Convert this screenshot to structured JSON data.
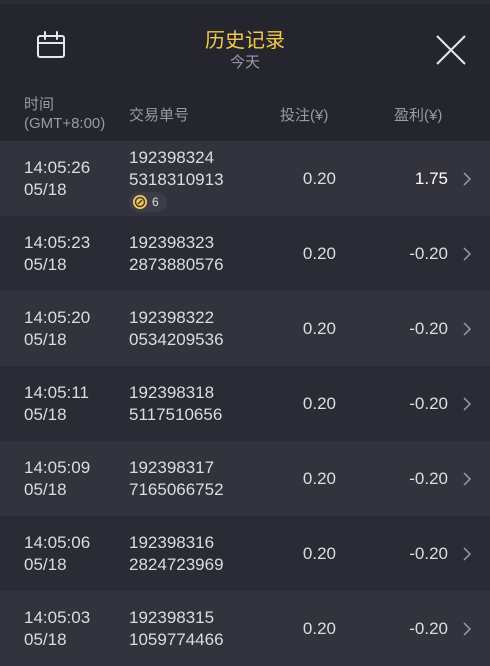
{
  "header": {
    "title": "历史记录",
    "subtitle": "今天"
  },
  "columns": {
    "time_line1": "时间",
    "time_line2": "(GMT+8:00)",
    "order": "交易单号",
    "bet": "投注(¥)",
    "profit": "盈利(¥)"
  },
  "rows": [
    {
      "time": "14:05:26",
      "date": "05/18",
      "order1": "192398324",
      "order2": "5318310913",
      "bet": "0.20",
      "profit": "1.75",
      "badge": "6"
    },
    {
      "time": "14:05:23",
      "date": "05/18",
      "order1": "192398323",
      "order2": "2873880576",
      "bet": "0.20",
      "profit": "-0.20"
    },
    {
      "time": "14:05:20",
      "date": "05/18",
      "order1": "192398322",
      "order2": "0534209536",
      "bet": "0.20",
      "profit": "-0.20"
    },
    {
      "time": "14:05:11",
      "date": "05/18",
      "order1": "192398318",
      "order2": "5117510656",
      "bet": "0.20",
      "profit": "-0.20"
    },
    {
      "time": "14:05:09",
      "date": "05/18",
      "order1": "192398317",
      "order2": "7165066752",
      "bet": "0.20",
      "profit": "-0.20"
    },
    {
      "time": "14:05:06",
      "date": "05/18",
      "order1": "192398316",
      "order2": "2824723969",
      "bet": "0.20",
      "profit": "-0.20"
    },
    {
      "time": "14:05:03",
      "date": "05/18",
      "order1": "192398315",
      "order2": "1059774466",
      "bet": "0.20",
      "profit": "-0.20"
    }
  ],
  "colors": {
    "accent_title": "#f5c94a",
    "background": "#2b2b35",
    "header_bg": "#25252e"
  }
}
